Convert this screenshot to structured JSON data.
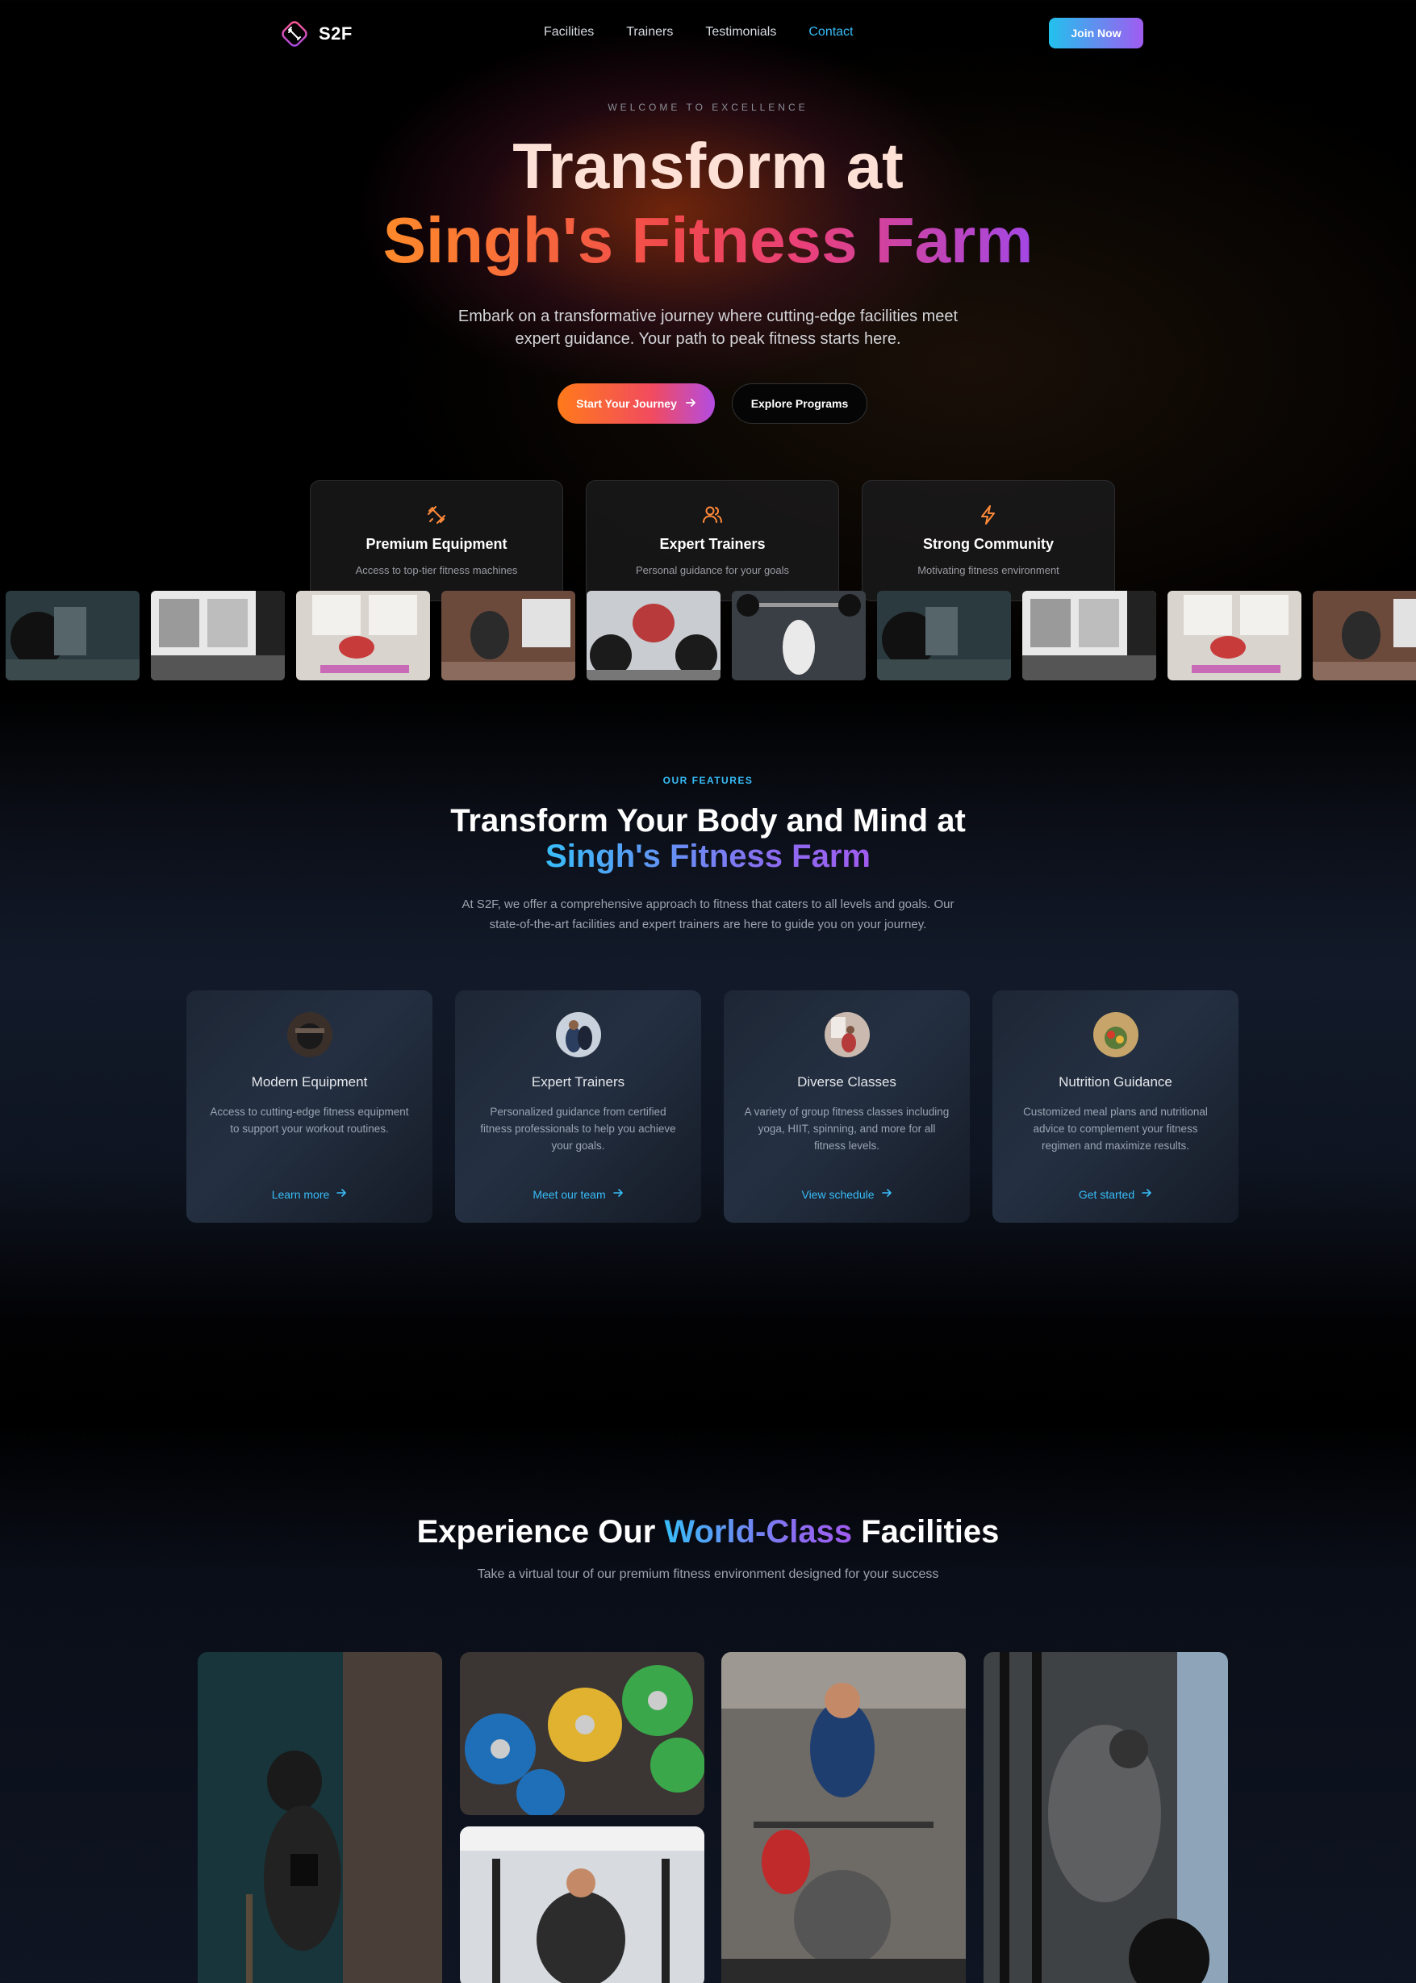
{
  "nav": {
    "logo_text": "S2F",
    "links": [
      "Facilities",
      "Trainers",
      "Testimonials",
      "Contact"
    ],
    "active_link": "Contact",
    "join_label": "Join Now"
  },
  "hero": {
    "eyebrow": "WELCOME TO EXCELLENCE",
    "title_line1": "Transform at",
    "title_line2": "Singh's Fitness Farm",
    "subtitle": "Embark on a transformative journey where cutting-edge facilities meet expert guidance. Your path to peak fitness starts here.",
    "primary_cta": "Start Your Journey",
    "secondary_cta": "Explore Programs",
    "cards": [
      {
        "icon": "dumbbell-icon",
        "title": "Premium Equipment",
        "desc": "Access to top-tier fitness machines"
      },
      {
        "icon": "users-icon",
        "title": "Expert Trainers",
        "desc": "Personal guidance for your goals"
      },
      {
        "icon": "lightning-icon",
        "title": "Strong Community",
        "desc": "Motivating fitness environment"
      }
    ]
  },
  "features": {
    "eyebrow": "OUR FEATURES",
    "title_line1": "Transform Your Body and Mind at",
    "title_line2": "Singh's Fitness Farm",
    "subtitle": "At S2F, we offer a comprehensive approach to fitness that caters to all levels and goals. Our state-of-the-art facilities and expert trainers are here to guide you on your journey.",
    "cards": [
      {
        "title": "Modern Equipment",
        "desc": "Access to cutting-edge fitness equipment to support your workout routines.",
        "link": "Learn more"
      },
      {
        "title": "Expert Trainers",
        "desc": "Personalized guidance from certified fitness professionals to help you achieve your goals.",
        "link": "Meet our team"
      },
      {
        "title": "Diverse Classes",
        "desc": "A variety of group fitness classes including yoga, HIIT, spinning, and more for all fitness levels.",
        "link": "View schedule"
      },
      {
        "title": "Nutrition Guidance",
        "desc": "Customized meal plans and nutritional advice to complement your fitness regimen and maximize results.",
        "link": "Get started"
      }
    ]
  },
  "facilities": {
    "title_pre": "Experience Our",
    "title_accent": "World-Class",
    "title_post": "Facilities",
    "subtitle": "Take a virtual tour of our premium fitness environment designed for your success"
  },
  "colors": {
    "accent_cyan": "#38bdf8",
    "accent_purple": "#a05cf0",
    "accent_orange": "#ff7a1a"
  }
}
